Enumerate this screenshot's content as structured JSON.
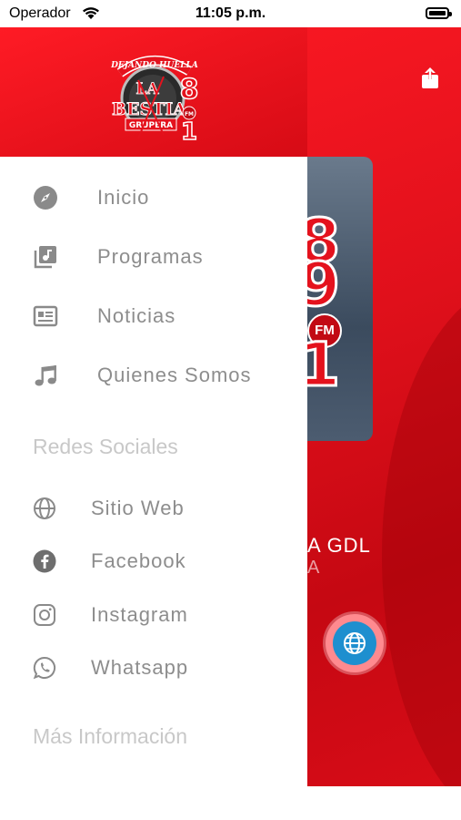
{
  "status_bar": {
    "carrier": "Operador",
    "time": "11:05 p.m."
  },
  "colors": {
    "brand_red": "#e4121d",
    "drawer_text": "#8d8d8d",
    "section_text": "#c8c8c8",
    "icon_gray": "#8a8a8a",
    "globe_blue": "#1e8fcf"
  },
  "logo": {
    "top_text": "DEJANDO HUELLA",
    "main_text": "LA BESTIA",
    "sub_text": "GRUPERA",
    "frequency": "89 1",
    "fm": "FM"
  },
  "menu": {
    "items": [
      {
        "label": "Inicio",
        "icon": "compass-icon"
      },
      {
        "label": "Programas",
        "icon": "music-library-icon"
      },
      {
        "label": "Noticias",
        "icon": "newspaper-icon"
      },
      {
        "label": "Quienes  Somos",
        "icon": "music-note-icon"
      }
    ]
  },
  "social": {
    "title": "Redes Sociales",
    "items": [
      {
        "label": "Sitio  Web",
        "icon": "globe-icon"
      },
      {
        "label": "Facebook",
        "icon": "facebook-icon"
      },
      {
        "label": "Instagram",
        "icon": "instagram-icon"
      },
      {
        "label": "Whatsapp",
        "icon": "whatsapp-icon"
      }
    ]
  },
  "more_info": {
    "title": "Más Información"
  },
  "main": {
    "hero_digits": [
      "8",
      "9",
      "1"
    ],
    "hero_fm": "FM",
    "station_line1": "A  GDL",
    "station_line2": "A"
  }
}
